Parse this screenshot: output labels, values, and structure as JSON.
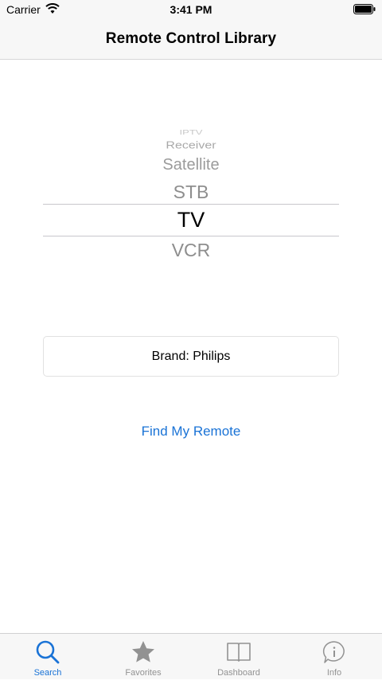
{
  "status_bar": {
    "carrier": "Carrier",
    "time": "3:41 PM"
  },
  "nav": {
    "title": "Remote Control Library"
  },
  "picker": {
    "items": [
      "IPTV",
      "Receiver",
      "Satellite",
      "STB",
      "TV",
      "VCR"
    ],
    "selected": "TV"
  },
  "brand_button": {
    "label": "Brand: Philips"
  },
  "find_button": {
    "label": "Find My Remote"
  },
  "tab_bar": {
    "tabs": [
      {
        "label": "Search",
        "icon": "search-icon",
        "active": true
      },
      {
        "label": "Favorites",
        "icon": "star-icon",
        "active": false
      },
      {
        "label": "Dashboard",
        "icon": "book-icon",
        "active": false
      },
      {
        "label": "Info",
        "icon": "info-icon",
        "active": false
      }
    ]
  },
  "colors": {
    "accent": "#1a73d6",
    "inactive_tab": "#929292",
    "bar_background": "#f7f7f7"
  }
}
